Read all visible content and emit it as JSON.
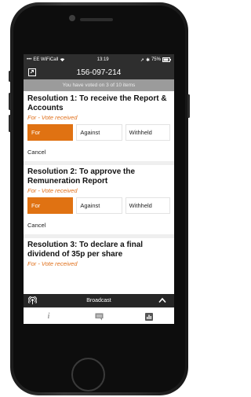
{
  "status_bar": {
    "carrier": "EE WiFiCall",
    "time": "13:19",
    "battery": "75%"
  },
  "header": {
    "title": "156-097-214",
    "icon": "exit-icon"
  },
  "banner": "You have voted on 3 of 10 items",
  "resolutions": [
    {
      "title": "Resolution 1: To receive the Report & Accounts",
      "status": "For - Vote received",
      "options": [
        "For",
        "Against",
        "Withheld"
      ],
      "selected": "For",
      "cancel_label": "Cancel"
    },
    {
      "title": "Resolution 2: To approve the Remuneration Report",
      "status": "For - Vote received",
      "options": [
        "For",
        "Against",
        "Withheld"
      ],
      "selected": "For",
      "cancel_label": "Cancel"
    },
    {
      "title": "Resolution 3: To declare a final dividend of 35p per share",
      "status": "For - Vote received"
    }
  ],
  "broadcast": {
    "label": "Broadcast",
    "icon": "broadcast-icon",
    "toggle_icon": "chevron-up-icon"
  },
  "tabs": [
    {
      "icon": "info-icon"
    },
    {
      "icon": "chat-icon"
    },
    {
      "icon": "poll-icon"
    }
  ],
  "colors": {
    "accent": "#e07212",
    "status_text": "#e06f1a",
    "dark_bar": "#2e2e2e",
    "banner_bg": "#9b9b9b"
  }
}
